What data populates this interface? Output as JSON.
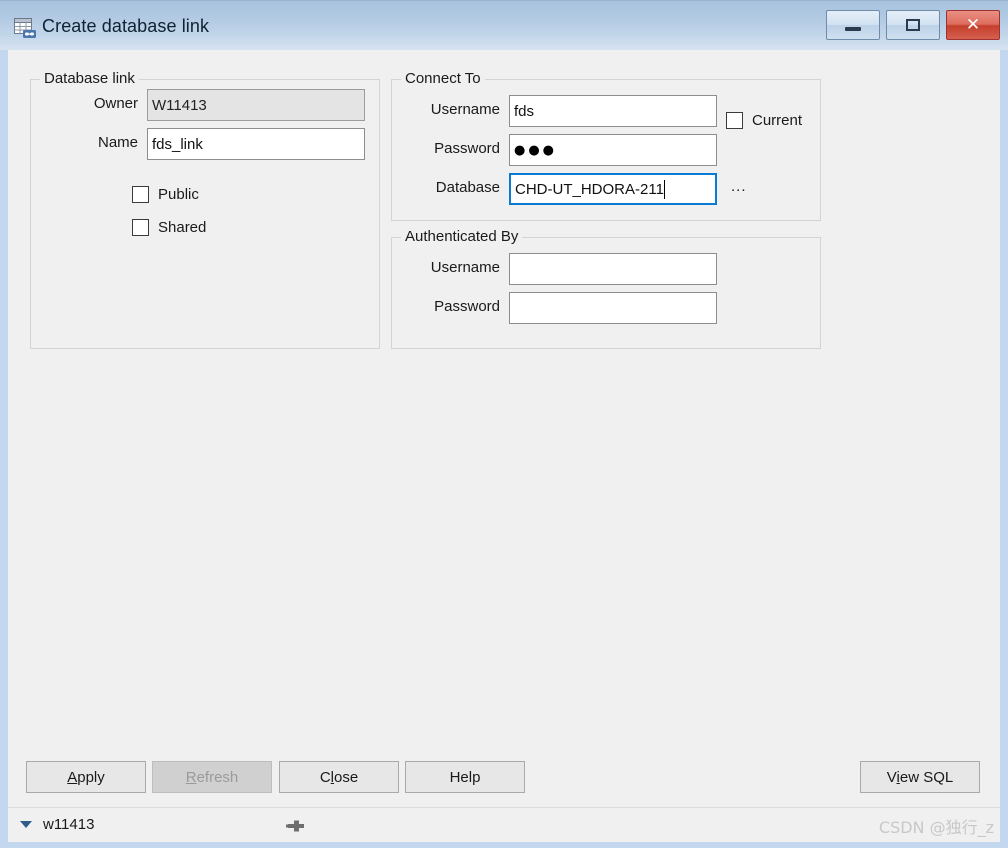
{
  "window": {
    "title": "Create database link",
    "icon": "database-link-icon",
    "controls": {
      "minimize": "minimize-icon",
      "maximize": "maximize-icon",
      "close": "✕"
    }
  },
  "database_link_group": {
    "legend": "Database link",
    "owner_label": "Owner",
    "owner_value": "W11413",
    "owner_disabled": true,
    "name_label": "Name",
    "name_value": "fds_link",
    "checkboxes": [
      {
        "label": "Public",
        "checked": false
      },
      {
        "label": "Shared",
        "checked": false
      }
    ]
  },
  "connect_to_group": {
    "legend": "Connect To",
    "username_label": "Username",
    "username_value": "fds",
    "password_label": "Password",
    "password_value": "●●●",
    "database_label": "Database",
    "database_value": "CHD-UT_HDORA-211",
    "database_focused": true,
    "browse_label": "...",
    "current_checkbox": {
      "label": "Current",
      "checked": false
    }
  },
  "authenticated_by_group": {
    "legend": "Authenticated By",
    "username_label": "Username",
    "username_value": "",
    "password_label": "Password",
    "password_value": ""
  },
  "buttons": {
    "apply": {
      "pre": "",
      "mnemonic": "A",
      "post": "pply",
      "enabled": true
    },
    "refresh": {
      "pre": "",
      "mnemonic": "R",
      "post": "efresh",
      "enabled": false
    },
    "close": {
      "pre": "C",
      "mnemonic": "l",
      "post": "ose",
      "enabled": true
    },
    "help": {
      "pre": "Help",
      "mnemonic": "",
      "post": "",
      "enabled": true
    },
    "view_sql": {
      "pre": "V",
      "mnemonic": "i",
      "post": "ew SQL",
      "enabled": true
    }
  },
  "statusbar": {
    "connection": "w11413",
    "dropdown_icon": "chevron-down-icon",
    "pin_icon": "pin-icon",
    "watermark": "CSDN @独行_z"
  },
  "colors": {
    "titlebar_top": "#a8c2de",
    "titlebar_bottom": "#d6e3f1",
    "frame": "#c3d8ee",
    "client_bg": "#f0f0f0",
    "focus_border": "#0a7bd4",
    "close_button": "#c43f2c"
  }
}
